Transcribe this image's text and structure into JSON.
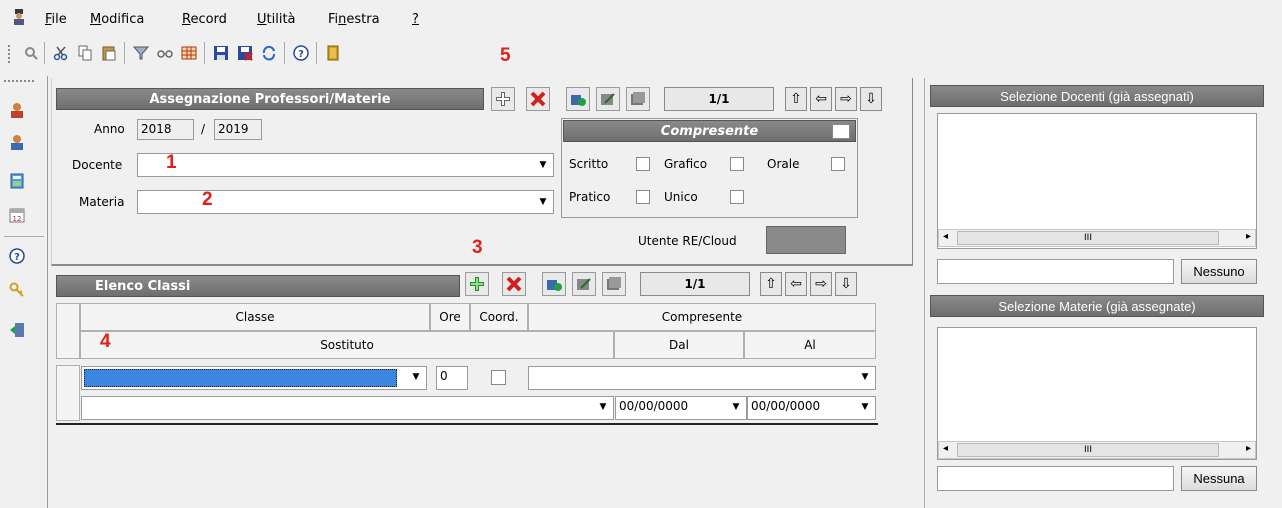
{
  "menu": {
    "items": [
      {
        "pre": "",
        "u": "F",
        "post": "ile"
      },
      {
        "pre": "",
        "u": "M",
        "post": "odifica"
      },
      {
        "pre": "",
        "u": "R",
        "post": "ecord"
      },
      {
        "pre": "",
        "u": "U",
        "post": "tilità"
      },
      {
        "pre": "Fi",
        "u": "n",
        "post": "estra"
      },
      {
        "pre": "",
        "u": "?",
        "post": ""
      }
    ]
  },
  "markers": {
    "m1": "1",
    "m2": "2",
    "m3": "3",
    "m4": "4",
    "m5": "5"
  },
  "assignment": {
    "header": "Assegnazione Professori/Materie",
    "record_counter": "1/1",
    "anno_label": "Anno",
    "anno_from": "2018",
    "anno_separator": "/",
    "anno_to": "2019",
    "docente_label": "Docente",
    "docente_value": "",
    "materia_label": "Materia",
    "materia_value": ""
  },
  "compresente": {
    "header": "Compresente",
    "scritto": "Scritto",
    "grafico": "Grafico",
    "orale": "Orale",
    "pratico": "Pratico",
    "unico": "Unico",
    "utente_label": "Utente RE/Cloud"
  },
  "classes": {
    "header": "Elenco Classi",
    "record_counter": "1/1",
    "columns": {
      "classe": "Classe",
      "ore": "Ore",
      "coord": "Coord.",
      "compresente": "Compresente",
      "sostituto": "Sostituto",
      "dal": "Dal",
      "al": "Al"
    },
    "row": {
      "ore": "0",
      "dal": "00/00/0000",
      "al": "00/00/0000"
    }
  },
  "docenti_panel": {
    "header": "Selezione Docenti (già assegnati)",
    "scroll_thumb": "III",
    "search_value": "",
    "button": "Nessuno"
  },
  "materie_panel": {
    "header": "Selezione Materie (già assegnate)",
    "scroll_thumb": "III",
    "search_value": "",
    "button": "Nessuna"
  }
}
